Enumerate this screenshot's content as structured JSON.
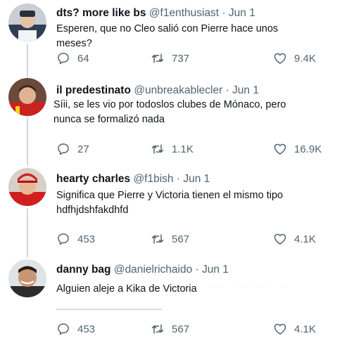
{
  "tweets": [
    {
      "name": "dts? more like bs",
      "handle": "@f1enthusiast",
      "time": "· Jun 1",
      "text": "Esperen, que no Cleo salió con Pierre hace unos meses?",
      "replies": "64",
      "retweets": "737",
      "likes": "9.4K"
    },
    {
      "name": "il predestinato",
      "handle": "@unbreakablecler",
      "time": "· Jun 1",
      "text": "Síii, se les vio por todoslos clubes de Mónaco, pero nunca se formalizó nada",
      "replies": "27",
      "retweets": "1.1K",
      "likes": "16.9K"
    },
    {
      "name": "hearty charles",
      "handle": "@f1bish",
      "time": "· Jun 1",
      "text": "Significa que Pierre y Victoria tienen el mismo tipo hdfhjdshfakdhfd",
      "replies": "453",
      "retweets": "567",
      "likes": "4.1K"
    },
    {
      "name": "danny bag",
      "handle": "@danielrichaido",
      "time": "· Jun 1",
      "text": "Alguien aleje a Kika de Victoria",
      "replies": "453",
      "retweets": "567",
      "likes": "4.1K"
    }
  ],
  "icons": {
    "reply": "reply-icon",
    "retweet": "retweet-icon",
    "like": "heart-icon"
  },
  "colors": {
    "text": "#0f1419",
    "secondary": "#536471",
    "thread_line": "#cfd9de"
  }
}
